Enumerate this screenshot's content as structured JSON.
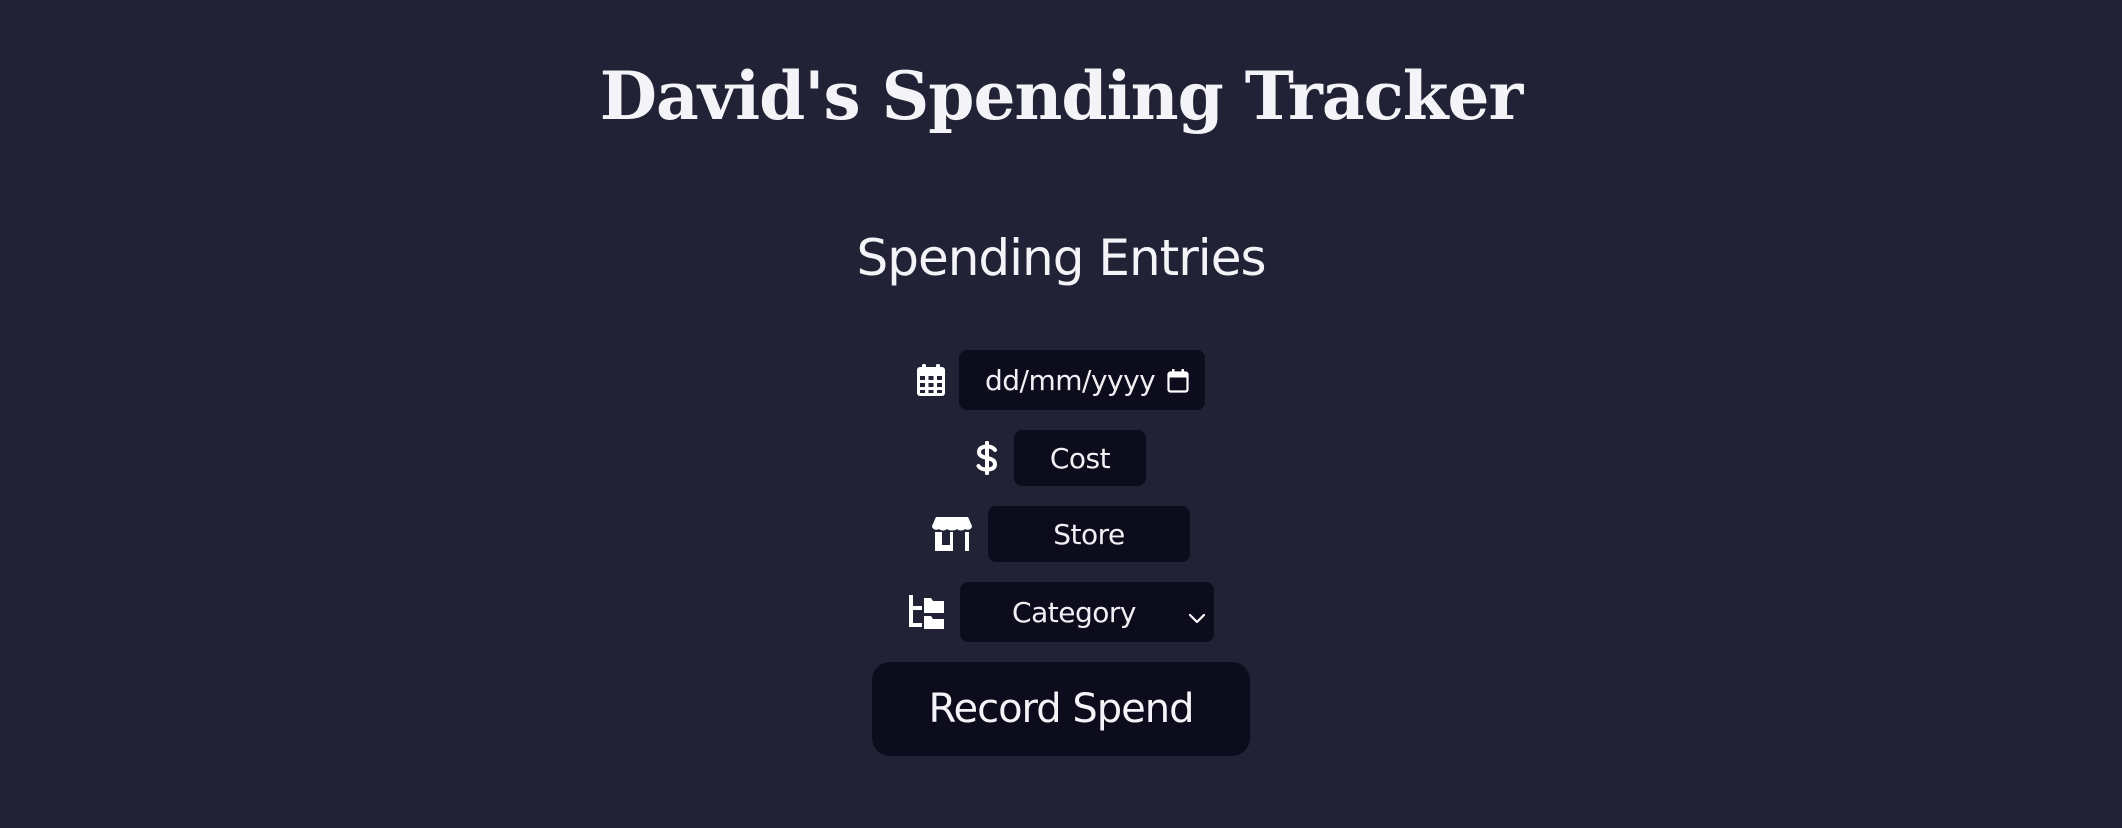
{
  "header": {
    "title": "David's Spending Tracker"
  },
  "main": {
    "section_title": "Spending Entries",
    "form": {
      "date": {
        "placeholder": "dd/mm/yyyy",
        "icon": "calendar-icon"
      },
      "cost": {
        "placeholder": "Cost",
        "icon": "dollar-icon"
      },
      "store": {
        "placeholder": "Store",
        "icon": "store-icon"
      },
      "category": {
        "selected": "Category",
        "icon": "folder-tree-icon"
      },
      "submit_label": "Record Spend"
    }
  },
  "colors": {
    "background": "#222236",
    "field_background": "#0c0c1c",
    "text": "#f4f4f8"
  }
}
